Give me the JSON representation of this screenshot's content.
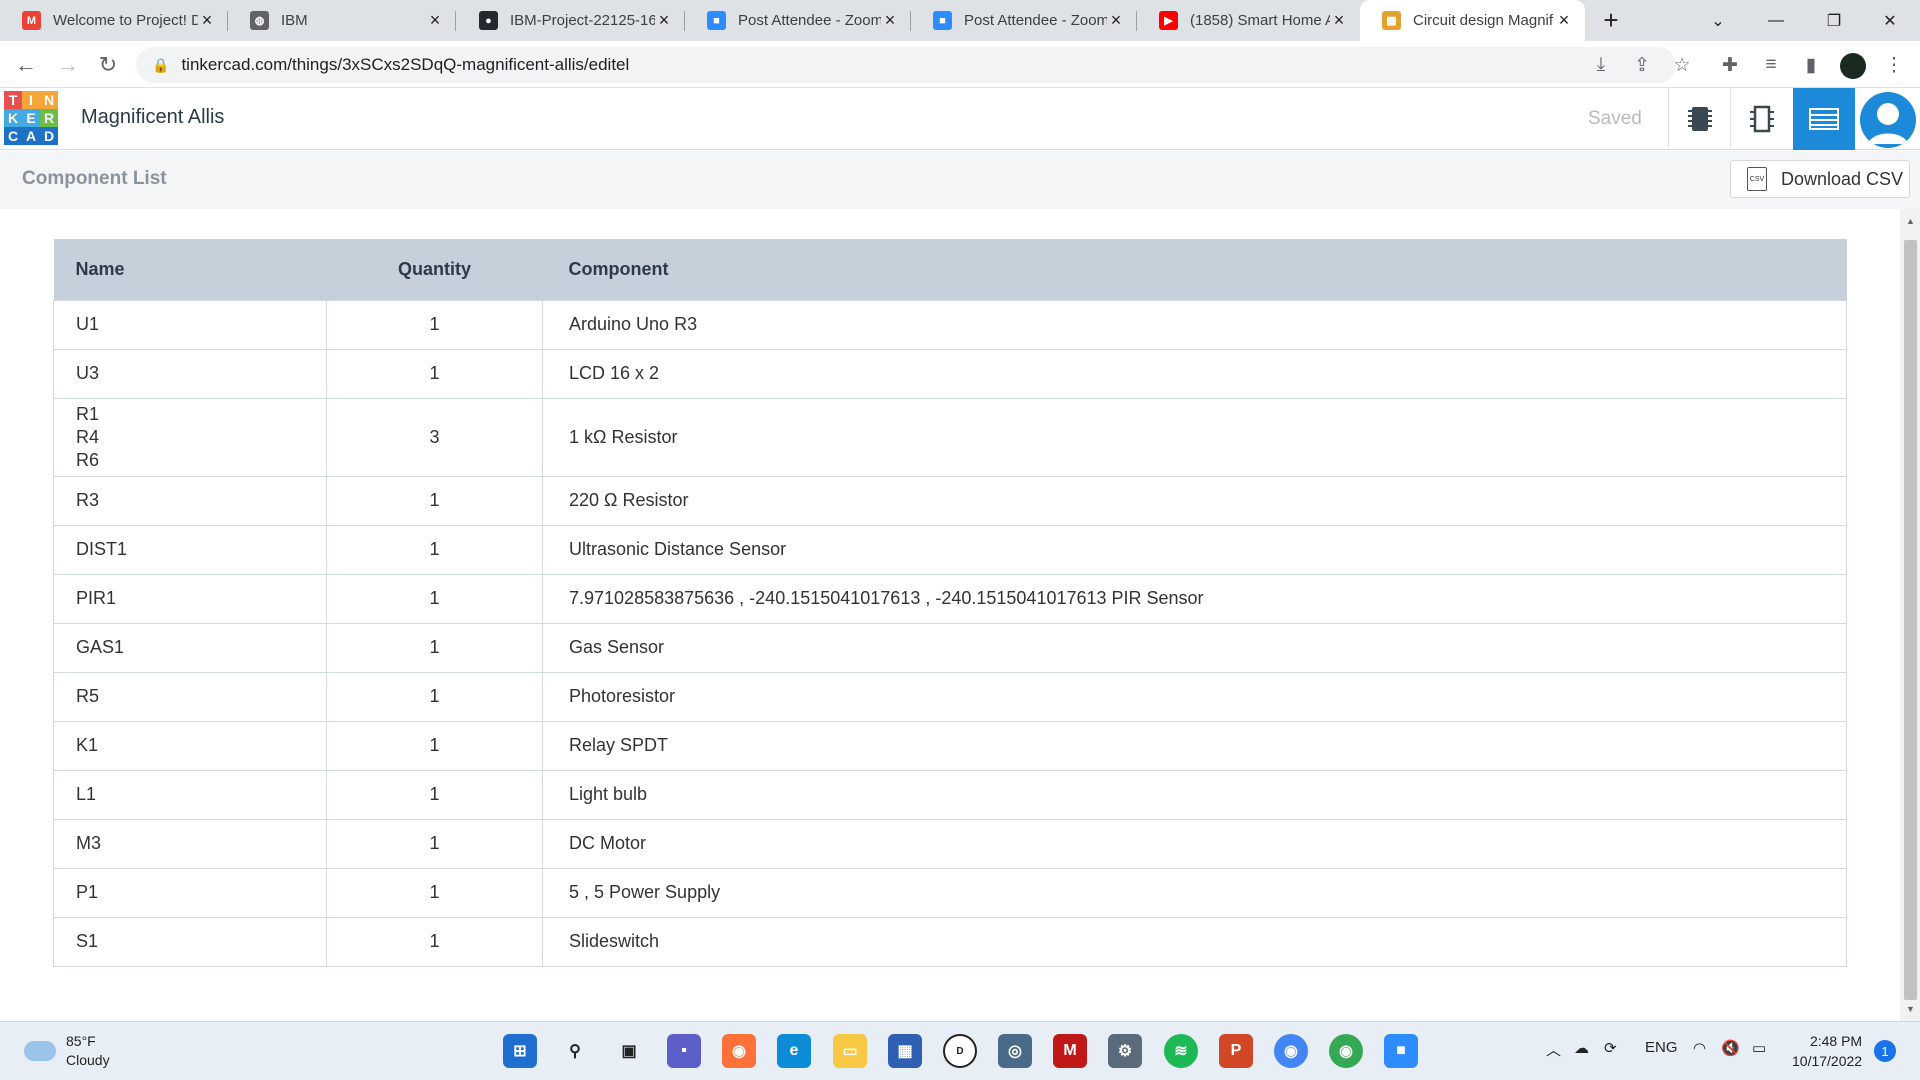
{
  "browser": {
    "tabs": [
      {
        "title": "Welcome to Project! D",
        "icon": "gmail-icon",
        "color": "#ea4335",
        "glyph": "M"
      },
      {
        "title": "IBM",
        "icon": "globe-icon",
        "color": "#5f6368",
        "glyph": "◍"
      },
      {
        "title": "IBM-Project-22125-16",
        "icon": "github-icon",
        "color": "#24292f",
        "glyph": "●"
      },
      {
        "title": "Post Attendee - Zoom",
        "icon": "zoom-icon",
        "color": "#2d8cff",
        "glyph": "■"
      },
      {
        "title": "Post Attendee - Zoom",
        "icon": "zoom-icon",
        "color": "#2d8cff",
        "glyph": "■"
      },
      {
        "title": "(1858) Smart Home A",
        "icon": "youtube-icon",
        "color": "#ff0000",
        "glyph": "▶"
      },
      {
        "title": "Circuit design Magnif",
        "icon": "tinkercad-icon",
        "color": "#e2a230",
        "glyph": "▦",
        "active": true
      }
    ],
    "url": "tinkercad.com/things/3xSCxs2SDqQ-magnificent-allis/editel"
  },
  "app": {
    "logo_letters": [
      "T",
      "I",
      "N",
      "K",
      "E",
      "R",
      "C",
      "A",
      "D"
    ],
    "project_name": "Magnificent Allis",
    "save_status": "Saved"
  },
  "subbar": {
    "title": "Component List",
    "download_label": "Download CSV",
    "csv_icon_text": "CSV"
  },
  "table": {
    "headers": {
      "name": "Name",
      "quantity": "Quantity",
      "component": "Component"
    },
    "rows": [
      {
        "name": [
          "U1"
        ],
        "quantity": "1",
        "component": "Arduino Uno R3"
      },
      {
        "name": [
          "U3"
        ],
        "quantity": "1",
        "component": "LCD 16 x 2"
      },
      {
        "name": [
          "R1",
          "R4",
          "R6"
        ],
        "quantity": "3",
        "component": "1 kΩ Resistor"
      },
      {
        "name": [
          "R3"
        ],
        "quantity": "1",
        "component": "220 Ω Resistor"
      },
      {
        "name": [
          "DIST1"
        ],
        "quantity": "1",
        "component": "Ultrasonic Distance Sensor"
      },
      {
        "name": [
          "PIR1"
        ],
        "quantity": "1",
        "component": "7.971028583875636 , -240.1515041017613 , -240.1515041017613 PIR Sensor"
      },
      {
        "name": [
          "GAS1"
        ],
        "quantity": "1",
        "component": "Gas Sensor"
      },
      {
        "name": [
          "R5"
        ],
        "quantity": "1",
        "component": "Photoresistor"
      },
      {
        "name": [
          "K1"
        ],
        "quantity": "1",
        "component": "Relay SPDT"
      },
      {
        "name": [
          "L1"
        ],
        "quantity": "1",
        "component": "Light bulb"
      },
      {
        "name": [
          "M3"
        ],
        "quantity": "1",
        "component": "DC Motor"
      },
      {
        "name": [
          "P1"
        ],
        "quantity": "1",
        "component": "5 , 5 Power Supply"
      },
      {
        "name": [
          "S1"
        ],
        "quantity": "1",
        "component": "Slideswitch"
      }
    ]
  },
  "taskbar": {
    "weather_temp": "85°F",
    "weather_desc": "Cloudy",
    "language": "ENG",
    "time": "2:48 PM",
    "date": "10/17/2022",
    "notifications": "1"
  }
}
